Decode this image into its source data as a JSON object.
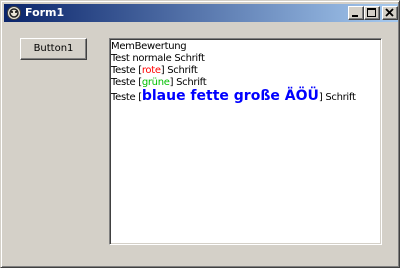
{
  "window": {
    "title": "Form1",
    "icon": "delphi-app-icon",
    "controls": {
      "minimize": "minimize-icon",
      "maximize": "maximize-icon",
      "close": "close-icon"
    },
    "titlebar_colors": [
      "#0a246a",
      "#a6caf0"
    ]
  },
  "button1": {
    "label": "Button1"
  },
  "memo": {
    "line1": "MemBewertung",
    "line2": "Test normale Schrift",
    "line3": {
      "prefix": "Teste [",
      "colored": "rote",
      "suffix": "] Schrift",
      "color": "#ff0000"
    },
    "line4": {
      "prefix": "Teste [",
      "colored": "grüne",
      "suffix": "] Schrift",
      "color": "#00c000"
    },
    "line5": {
      "prefix": "Teste [",
      "colored": "blaue fette große ÄÖÜ",
      "suffix": "] Schrift",
      "color": "#0000ff"
    }
  }
}
